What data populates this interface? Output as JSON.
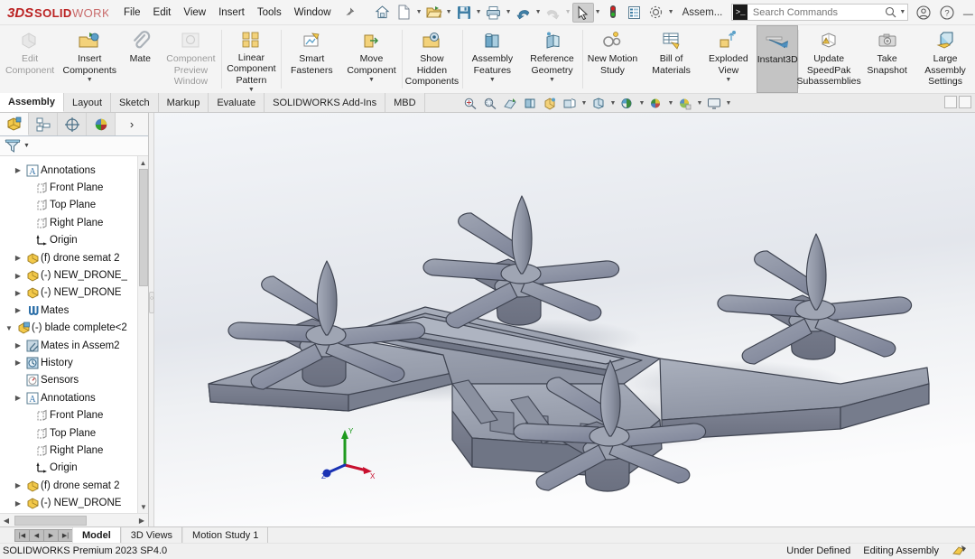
{
  "app": {
    "brand_ds": "3DS",
    "brand_solid": "SOLID",
    "brand_works": "WORKS",
    "document_name": "Assem...",
    "accent_red": "#bb2222",
    "accent_blue": "#0b6ea8",
    "model_gray": "#8b8f9c"
  },
  "menu": {
    "items": [
      {
        "label": "File",
        "name": "menu-file"
      },
      {
        "label": "Edit",
        "name": "menu-edit"
      },
      {
        "label": "View",
        "name": "menu-view"
      },
      {
        "label": "Insert",
        "name": "menu-insert"
      },
      {
        "label": "Tools",
        "name": "menu-tools"
      },
      {
        "label": "Window",
        "name": "menu-window"
      }
    ],
    "pin_icon": "pin-icon"
  },
  "quick_access": [
    {
      "name": "home-icon",
      "caret": false
    },
    {
      "name": "new-document-icon",
      "caret": true
    },
    {
      "name": "open-folder-icon",
      "caret": true
    },
    {
      "name": "save-icon",
      "caret": true
    },
    {
      "name": "print-icon",
      "caret": true
    },
    {
      "name": "undo-icon",
      "caret": true
    },
    {
      "name": "redo-icon",
      "caret": true
    },
    {
      "name": "select-arrow-icon",
      "caret": true,
      "selected": true
    },
    {
      "name": "rebuild-traffic-light-icon",
      "caret": false
    },
    {
      "name": "options-list-icon",
      "caret": false
    },
    {
      "name": "settings-gear-icon",
      "caret": true
    }
  ],
  "search": {
    "placeholder": "Search Commands",
    "value": "",
    "prefix_icon": "command-prompt-icon",
    "magnifier_icon": "search-icon",
    "dropdown_icon": "chevron-down-icon"
  },
  "title_right": [
    {
      "name": "user-account-icon"
    },
    {
      "name": "help-question-icon"
    },
    {
      "name": "minimize-window-button",
      "label": "—"
    }
  ],
  "ribbon": {
    "buttons": [
      {
        "label": "Edit Component",
        "name": "edit-component-button",
        "icon": "edit-component-icon",
        "disabled": true,
        "caret": false
      },
      {
        "label": "Insert Components",
        "name": "insert-components-button",
        "icon": "insert-components-icon",
        "disabled": false,
        "caret": true
      },
      {
        "label": "Mate",
        "name": "mate-button",
        "icon": "mate-paperclip-icon",
        "disabled": false,
        "caret": false
      },
      {
        "label": "Component Preview Window",
        "name": "component-preview-window-button",
        "icon": "component-preview-icon",
        "disabled": true,
        "caret": false
      },
      {
        "label": "Linear Component Pattern",
        "name": "linear-component-pattern-button",
        "icon": "linear-pattern-icon",
        "disabled": false,
        "caret": true
      },
      {
        "label": "Smart Fasteners",
        "name": "smart-fasteners-button",
        "icon": "smart-fasteners-icon",
        "disabled": false,
        "caret": false
      },
      {
        "label": "Move Component",
        "name": "move-component-button",
        "icon": "move-component-icon",
        "disabled": false,
        "caret": true
      },
      {
        "label": "Show Hidden Components",
        "name": "show-hidden-components-button",
        "icon": "show-hidden-icon",
        "disabled": false,
        "caret": false
      },
      {
        "label": "Assembly Features",
        "name": "assembly-features-button",
        "icon": "assembly-features-icon",
        "disabled": false,
        "caret": true
      },
      {
        "label": "Reference Geometry",
        "name": "reference-geometry-button",
        "icon": "reference-geometry-icon",
        "disabled": false,
        "caret": true
      },
      {
        "label": "New Motion Study",
        "name": "new-motion-study-button",
        "icon": "new-motion-study-icon",
        "disabled": false,
        "caret": false
      },
      {
        "label": "Bill of Materials",
        "name": "bill-of-materials-button",
        "icon": "bill-of-materials-icon",
        "disabled": false,
        "caret": false
      },
      {
        "label": "Exploded View",
        "name": "exploded-view-button",
        "icon": "exploded-view-icon",
        "disabled": false,
        "caret": true
      },
      {
        "label": "Instant3D",
        "name": "instant3d-button",
        "icon": "instant3d-icon",
        "disabled": false,
        "caret": false,
        "active": true
      },
      {
        "label": "Update SpeedPak Subassemblies",
        "name": "update-speedpak-button",
        "icon": "update-speedpak-icon",
        "disabled": false,
        "caret": false
      },
      {
        "label": "Take Snapshot",
        "name": "take-snapshot-button",
        "icon": "camera-icon",
        "disabled": false,
        "caret": false
      },
      {
        "label": "Large Assembly Settings",
        "name": "large-assembly-settings-button",
        "icon": "large-assembly-icon",
        "disabled": false,
        "caret": false
      }
    ]
  },
  "command_tabs": {
    "items": [
      {
        "label": "Assembly",
        "name": "tab-assembly",
        "selected": true
      },
      {
        "label": "Layout",
        "name": "tab-layout",
        "selected": false
      },
      {
        "label": "Sketch",
        "name": "tab-sketch",
        "selected": false
      },
      {
        "label": "Markup",
        "name": "tab-markup",
        "selected": false
      },
      {
        "label": "Evaluate",
        "name": "tab-evaluate",
        "selected": false
      },
      {
        "label": "SOLIDWORKS Add-Ins",
        "name": "tab-solidworks-add-ins",
        "selected": false
      },
      {
        "label": "MBD",
        "name": "tab-mbd",
        "selected": false
      }
    ],
    "view_tools": [
      {
        "name": "zoom-to-fit-icon",
        "caret": false
      },
      {
        "name": "zoom-to-area-icon",
        "caret": false
      },
      {
        "name": "previous-view-icon",
        "caret": false
      },
      {
        "name": "section-view-icon",
        "caret": false
      },
      {
        "name": "view-orientation-icon",
        "caret": false
      },
      {
        "name": "display-style-icon",
        "caret": true
      },
      {
        "name": "hide-show-items-icon",
        "caret": true
      },
      {
        "name": "edit-appearance-icon",
        "caret": true
      },
      {
        "name": "apply-scene-icon",
        "caret": true
      },
      {
        "name": "view-settings-icon",
        "caret": true
      },
      {
        "name": "viewport-layout-icon",
        "caret": true
      }
    ]
  },
  "feature_manager": {
    "tabs": [
      {
        "name": "feature-manager-design-tree-tab",
        "icon": "feature-tree-icon",
        "selected": true
      },
      {
        "name": "property-manager-tab",
        "icon": "property-manager-icon",
        "selected": false
      },
      {
        "name": "configuration-manager-tab",
        "icon": "configuration-icon",
        "selected": false
      },
      {
        "name": "display-manager-tab",
        "icon": "display-manager-icon",
        "selected": false
      }
    ],
    "expand_arrow": "›",
    "filter": {
      "name": "filter-icon",
      "placeholder": ""
    },
    "tree": [
      {
        "label": "Annotations",
        "icon": "annotations-icon",
        "indent": 1,
        "expandable": true,
        "expanded": false
      },
      {
        "label": "Front Plane",
        "icon": "plane-icon",
        "indent": 2,
        "expandable": false
      },
      {
        "label": "Top Plane",
        "icon": "plane-icon",
        "indent": 2,
        "expandable": false
      },
      {
        "label": "Right Plane",
        "icon": "plane-icon",
        "indent": 2,
        "expandable": false
      },
      {
        "label": "Origin",
        "icon": "origin-icon",
        "indent": 2,
        "expandable": false
      },
      {
        "label": "(f) drone semat 2",
        "icon": "component-icon",
        "indent": 1,
        "expandable": true
      },
      {
        "label": "(-) NEW_DRONE_",
        "icon": "component-icon",
        "indent": 1,
        "expandable": true
      },
      {
        "label": "(-) NEW_DRONE",
        "icon": "component-icon",
        "indent": 1,
        "expandable": true
      },
      {
        "label": "Mates",
        "icon": "mates-icon",
        "indent": 1,
        "expandable": true
      },
      {
        "label": "(-) blade complete<2",
        "icon": "assembly-icon",
        "indent": 0,
        "expandable": true,
        "expanded": true
      },
      {
        "label": "Mates in Assem2",
        "icon": "mates-in-assem-icon",
        "indent": 1,
        "expandable": true
      },
      {
        "label": "History",
        "icon": "history-icon",
        "indent": 1,
        "expandable": true
      },
      {
        "label": "Sensors",
        "icon": "sensors-icon",
        "indent": 1,
        "expandable": false
      },
      {
        "label": "Annotations",
        "icon": "annotations-icon",
        "indent": 1,
        "expandable": true
      },
      {
        "label": "Front Plane",
        "icon": "plane-icon",
        "indent": 2,
        "expandable": false
      },
      {
        "label": "Top Plane",
        "icon": "plane-icon",
        "indent": 2,
        "expandable": false
      },
      {
        "label": "Right Plane",
        "icon": "plane-icon",
        "indent": 2,
        "expandable": false
      },
      {
        "label": "Origin",
        "icon": "origin-icon",
        "indent": 2,
        "expandable": false
      },
      {
        "label": "(f) drone semat 2",
        "icon": "component-icon",
        "indent": 1,
        "expandable": true
      },
      {
        "label": "(-) NEW_DRONE",
        "icon": "component-icon",
        "indent": 1,
        "expandable": true
      }
    ]
  },
  "viewport": {
    "model_description": "quadcopter drone assembly, shaded isometric view",
    "triad": {
      "x_label": "X",
      "y_label": "Y",
      "z_label": "Z",
      "x_color": "#c8102e",
      "y_color": "#1f9a1f",
      "z_color": "#1a32b4"
    }
  },
  "bottom_tabs": {
    "nav": [
      "|◀",
      "◀",
      "▶",
      "▶|"
    ],
    "items": [
      {
        "label": "Model",
        "name": "bottom-tab-model",
        "selected": true
      },
      {
        "label": "3D Views",
        "name": "bottom-tab-3d-views",
        "selected": false
      },
      {
        "label": "Motion Study 1",
        "name": "bottom-tab-motion-study-1",
        "selected": false
      }
    ]
  },
  "status_bar": {
    "left": "SOLIDWORKS Premium 2023 SP4.0",
    "state": "Under Defined",
    "mode": "Editing Assembly",
    "icon": "editing-assembly-icon"
  }
}
